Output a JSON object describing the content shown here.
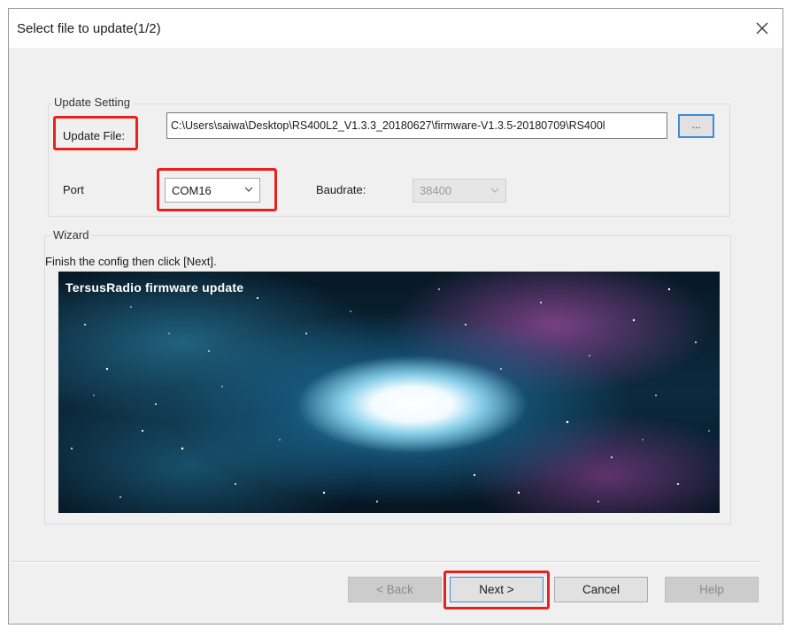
{
  "window": {
    "title": "Select file to update(1/2)"
  },
  "update_setting": {
    "group_label": "Update Setting",
    "file_label": "Update File:",
    "file_value": "C:\\Users\\saiwa\\Desktop\\RS400L2_V1.3.3_20180627\\firmware-V1.3.5-20180709\\RS400l",
    "browse_label": "...",
    "port_label": "Port",
    "port_value": "COM16",
    "baud_label": "Baudrate:",
    "baud_value": "38400"
  },
  "wizard": {
    "group_label": "Wizard",
    "instruction": "Finish the config then click [Next].",
    "banner_title": "TersusRadio firmware update"
  },
  "buttons": {
    "back": "< Back",
    "next": "Next >",
    "cancel": "Cancel",
    "help": "Help"
  },
  "colors": {
    "highlight": "#e8211d",
    "focus": "#3c8ed6"
  },
  "icons": {
    "close": "close-icon",
    "dropdown": "chevron-down-icon"
  }
}
